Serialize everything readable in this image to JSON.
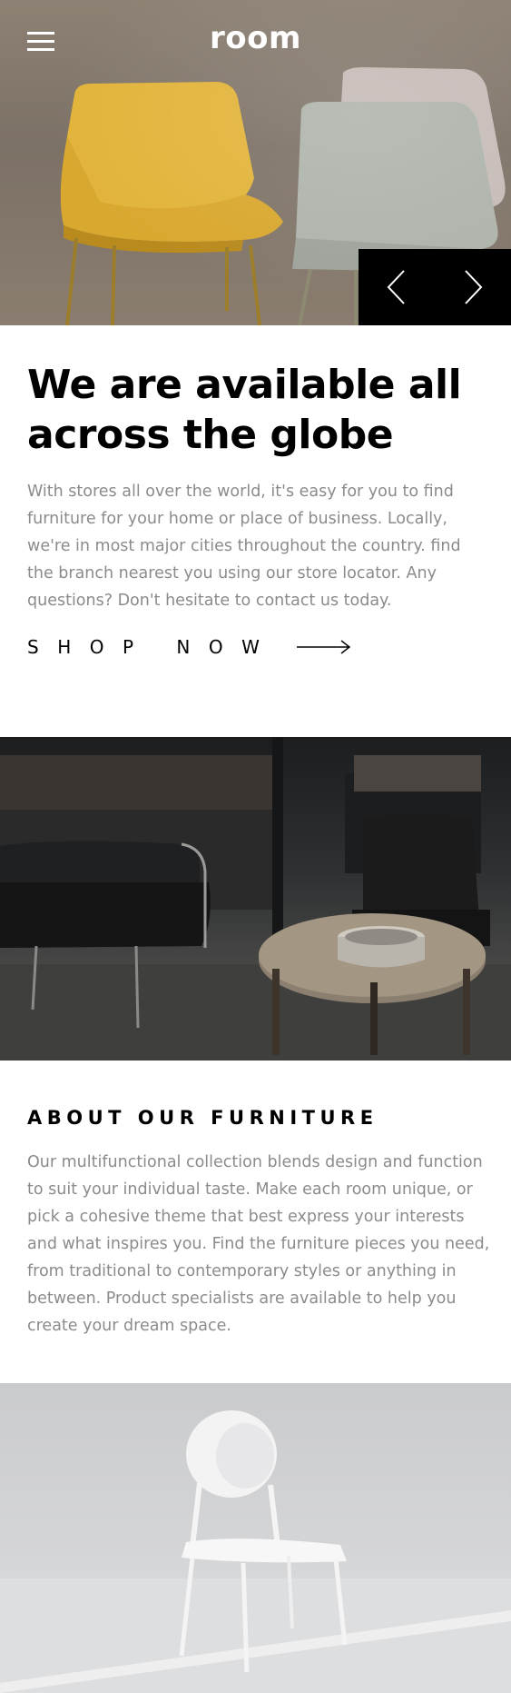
{
  "header": {
    "logo": "room",
    "menu_icon": "hamburger-menu-icon"
  },
  "hero": {
    "prev_icon": "chevron-left-icon",
    "next_icon": "chevron-right-icon"
  },
  "intro": {
    "headline": "We are available all across the globe",
    "paragraph": "With stores all over the world, it's easy for you to find furniture for your home or place of business. Locally, we're in most major cities throughout the country. find the branch nearest you using our store locator. Any questions? Don't hesitate to contact us today.",
    "cta_label": "SHOP NOW",
    "cta_icon": "arrow-right-icon"
  },
  "about": {
    "title": "ABOUT OUR FURNITURE",
    "paragraph": "Our multifunctional collection blends design and function to suit your individual taste. Make each room unique, or pick a cohesive theme that best express your interests and what inspires you. Find the furniture pieces you need, from traditional to contemporary styles or anything in between. Product specialists are available to help you create your dream space."
  },
  "colors": {
    "text_dark": "#000000",
    "text_muted": "#8b8b8b",
    "nav_bg": "#000000",
    "chair_yellow": "#e0b239",
    "chair_sage": "#b4bab1"
  }
}
